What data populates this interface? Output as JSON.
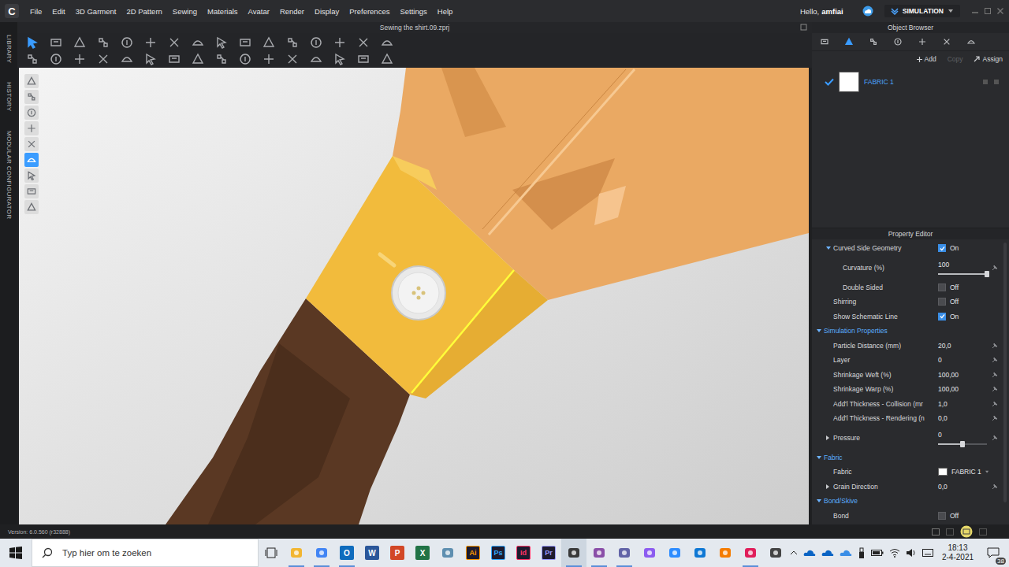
{
  "app": {
    "logo": "C"
  },
  "menu": [
    "File",
    "Edit",
    "3D Garment",
    "2D Pattern",
    "Sewing",
    "Materials",
    "Avatar",
    "Render",
    "Display",
    "Preferences",
    "Settings",
    "Help"
  ],
  "user": {
    "greeting": "Hello,",
    "name": "amfiai"
  },
  "mode": {
    "label": "SIMULATION"
  },
  "file_title": "Sewing the shirt.09.zprj",
  "side_tabs": [
    "LIBRARY",
    "HISTORY",
    "MODULAR CONFIGURATOR"
  ],
  "toolbar_rows": [
    [
      {
        "selected": true
      },
      {
        "selected": false
      },
      {
        "selected": false
      },
      {
        "selected": false
      },
      {
        "selected": false
      },
      {
        "selected": false
      },
      {
        "selected": false
      },
      {
        "selected": false
      },
      {
        "selected": false
      },
      {
        "selected": false
      },
      {
        "selected": false
      },
      {
        "selected": false
      },
      {
        "selected": false
      },
      {
        "selected": false
      },
      {
        "selected": false
      },
      {
        "selected": false
      }
    ],
    [
      {
        "selected": false
      },
      {
        "selected": false
      },
      {
        "selected": false
      },
      {
        "selected": false
      },
      {
        "selected": false
      },
      {
        "selected": false
      },
      {
        "selected": false
      },
      {
        "selected": false
      },
      {
        "selected": false
      },
      {
        "selected": false
      },
      {
        "selected": false
      },
      {
        "selected": false
      },
      {
        "selected": false
      },
      {
        "selected": false
      },
      {
        "selected": false
      },
      {
        "selected": false
      }
    ]
  ],
  "viewport_tools": [
    {
      "selected": false
    },
    {
      "selected": false
    },
    {
      "selected": false
    },
    {
      "selected": false
    },
    {
      "selected": false
    },
    {
      "selected": true
    },
    {
      "selected": false
    },
    {
      "selected": false
    },
    {
      "selected": false
    }
  ],
  "object_browser": {
    "title": "Object Browser",
    "tabs": [
      {
        "selected": false
      },
      {
        "selected": true
      },
      {
        "selected": false
      },
      {
        "selected": false
      },
      {
        "selected": false
      },
      {
        "selected": false
      },
      {
        "selected": false
      }
    ],
    "actions": [
      {
        "label": "Add",
        "disabled": false
      },
      {
        "label": "Copy",
        "disabled": true
      },
      {
        "label": "Assign",
        "disabled": false
      }
    ],
    "fabrics": [
      {
        "name": "FABRIC 1",
        "selected": true,
        "checked": true,
        "color": "#ffffff"
      }
    ]
  },
  "property_editor": {
    "title": "Property Editor",
    "rows": [
      {
        "kind": "toggle",
        "label": "Curved Side Geometry",
        "depth": 1,
        "expanded": true,
        "checked": true,
        "value": "On"
      },
      {
        "kind": "slider",
        "label": "Curvature (%)",
        "depth": 2,
        "value": "100",
        "level": 1
      },
      {
        "kind": "toggle",
        "label": "Double Sided",
        "depth": 2,
        "checked": false,
        "value": "Off"
      },
      {
        "kind": "toggle",
        "label": "Shirring",
        "depth": 1,
        "checked": false,
        "value": "Off"
      },
      {
        "kind": "toggle",
        "label": "Show Schematic Line",
        "depth": 1,
        "checked": true,
        "value": "On"
      },
      {
        "kind": "section",
        "label": "Simulation Properties",
        "depth": 0,
        "expanded": true
      },
      {
        "kind": "value",
        "label": "Particle Distance (mm)",
        "depth": 1,
        "value": "20,0"
      },
      {
        "kind": "value",
        "label": "Layer",
        "depth": 1,
        "value": "0"
      },
      {
        "kind": "value",
        "label": "Shrinkage Weft (%)",
        "depth": 1,
        "value": "100,00"
      },
      {
        "kind": "value",
        "label": "Shrinkage Warp (%)",
        "depth": 1,
        "value": "100,00"
      },
      {
        "kind": "value",
        "label": "Add'l Thickness - Collision (mr",
        "depth": 1,
        "value": "1,0"
      },
      {
        "kind": "value",
        "label": "Add'l Thickness - Rendering (n",
        "depth": 1,
        "value": "0,0"
      },
      {
        "kind": "slider",
        "label": "Pressure",
        "depth": 1,
        "expanded": false,
        "value": "0",
        "level": 0.5
      },
      {
        "kind": "section",
        "label": "Fabric",
        "depth": 0,
        "expanded": true
      },
      {
        "kind": "fabric",
        "label": "Fabric",
        "depth": 1,
        "value": "FABRIC 1",
        "color": "#ffffff"
      },
      {
        "kind": "value",
        "label": "Grain Direction",
        "depth": 1,
        "expanded": false,
        "value": "0,0"
      },
      {
        "kind": "section",
        "label": "Bond/Skive",
        "depth": 0,
        "expanded": true
      },
      {
        "kind": "toggle",
        "label": "Bond",
        "depth": 1,
        "checked": false,
        "value": "Off"
      }
    ]
  },
  "status_bar": {
    "version": "Version: 6.0.560 (r32888)"
  },
  "taskbar": {
    "search_placeholder": "Typ hier om te zoeken",
    "apps": [
      {
        "kind": "glyph",
        "label": "",
        "color": "#f2b632",
        "running": true,
        "active": false
      },
      {
        "kind": "glyph",
        "label": "",
        "color": "#4285f4",
        "running": true,
        "active": false
      },
      {
        "kind": "tile",
        "label": "O",
        "color": "#0f6cbd",
        "running": true,
        "active": false
      },
      {
        "kind": "tile",
        "label": "W",
        "color": "#2b579a",
        "running": false,
        "active": false
      },
      {
        "kind": "tile",
        "label": "P",
        "color": "#d24726",
        "running": false,
        "active": false
      },
      {
        "kind": "tile",
        "label": "X",
        "color": "#217346",
        "running": false,
        "active": false
      },
      {
        "kind": "glyph",
        "label": "",
        "color": "#5f8fb0",
        "running": false,
        "active": false
      },
      {
        "kind": "badge",
        "label": "Ai",
        "color": "#ff9a00",
        "running": false,
        "active": false
      },
      {
        "kind": "badge",
        "label": "Ps",
        "color": "#31a8ff",
        "running": false,
        "active": false
      },
      {
        "kind": "badge",
        "label": "Id",
        "color": "#ff3366",
        "running": false,
        "active": false
      },
      {
        "kind": "badge",
        "label": "Pr",
        "color": "#9999ff",
        "running": false,
        "active": false
      },
      {
        "kind": "glyph",
        "label": "",
        "color": "#3a3a3a",
        "running": true,
        "active": true
      },
      {
        "kind": "glyph",
        "label": "",
        "color": "#8a4fa8",
        "running": true,
        "active": false
      },
      {
        "kind": "glyph",
        "label": "",
        "color": "#6264a7",
        "running": true,
        "active": false
      },
      {
        "kind": "glyph",
        "label": "",
        "color": "#8c5cf0",
        "running": false,
        "active": false
      },
      {
        "kind": "glyph",
        "label": "",
        "color": "#2d8cff",
        "running": false,
        "active": false
      },
      {
        "kind": "glyph",
        "label": "",
        "color": "#0f78d4",
        "running": false,
        "active": false
      },
      {
        "kind": "glyph",
        "label": "",
        "color": "#f57c00",
        "running": false,
        "active": false
      },
      {
        "kind": "glyph",
        "label": "",
        "color": "#e01e5a",
        "running": true,
        "active": false
      },
      {
        "kind": "glyph",
        "label": "",
        "color": "#444444",
        "running": false,
        "active": false
      }
    ],
    "time": "18:13",
    "date": "2-4-2021",
    "notifications": "38"
  }
}
